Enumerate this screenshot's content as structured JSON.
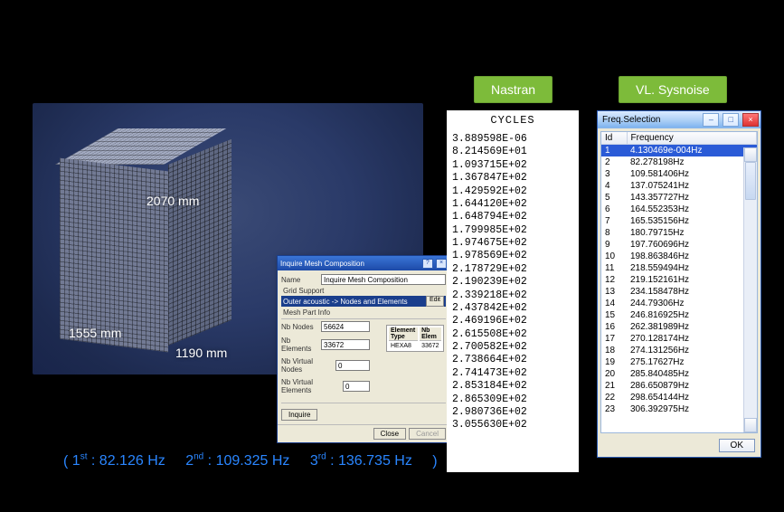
{
  "viewport": {
    "dim_height": "2070 mm",
    "dim_width": "1555 mm",
    "dim_depth": "1190 mm"
  },
  "mesh_dialog": {
    "title": "Inquire Mesh Composition",
    "name_label": "Name",
    "name_value": "Inquire Mesh Composition",
    "grid_support_label": "Grid Support",
    "selection_text": "Outer acoustic -> Nodes and Elements",
    "edit_btn": "Edit",
    "mesh_part_info_label": "Mesh Part Info",
    "nb_nodes_label": "Nb Nodes",
    "nb_nodes_value": "56624",
    "nb_elements_label": "Nb Elements",
    "nb_elements_value": "33672",
    "nb_vnodes_label": "Nb Virtual Nodes",
    "nb_vnodes_value": "0",
    "nb_velems_label": "Nb Virtual Elements",
    "nb_velems_value": "0",
    "elem_type_header": "Element Type",
    "nb_elem_header": "Nb Elem",
    "elem_type_val": "HEXA8",
    "nb_elem_val": "33672",
    "inquire_btn": "Inquire",
    "close_btn": "Close",
    "cancel_btn": "Cancel"
  },
  "tags": {
    "nastran": "Nastran",
    "sysnoise": "VL. Sysnoise"
  },
  "cycles": {
    "title": "CYCLES",
    "values": [
      "3.889598E-06",
      "8.214569E+01",
      "1.093715E+02",
      "1.367847E+02",
      "1.429592E+02",
      "1.644120E+02",
      "1.648794E+02",
      "1.799985E+02",
      "1.974675E+02",
      "1.978569E+02",
      "2.178729E+02",
      "2.190239E+02",
      "2.339218E+02",
      "2.437842E+02",
      "2.469196E+02",
      "2.615508E+02",
      "2.700582E+02",
      "2.738664E+02",
      "2.741473E+02",
      "2.853184E+02",
      "2.865309E+02",
      "2.980736E+02",
      "3.055630E+02"
    ]
  },
  "freq_window": {
    "title": "Freq.Selection",
    "min_icon": "–",
    "max_icon": "□",
    "close_icon": "×",
    "col_id": "Id",
    "col_freq": "Frequency",
    "rows": [
      {
        "id": "1",
        "freq": "4.130469e-004Hz",
        "selected": true
      },
      {
        "id": "2",
        "freq": "82.278198Hz"
      },
      {
        "id": "3",
        "freq": "109.581406Hz"
      },
      {
        "id": "4",
        "freq": "137.075241Hz"
      },
      {
        "id": "5",
        "freq": "143.357727Hz"
      },
      {
        "id": "6",
        "freq": "164.552353Hz"
      },
      {
        "id": "7",
        "freq": "165.535156Hz"
      },
      {
        "id": "8",
        "freq": "180.79715Hz"
      },
      {
        "id": "9",
        "freq": "197.760696Hz"
      },
      {
        "id": "10",
        "freq": "198.863846Hz"
      },
      {
        "id": "11",
        "freq": "218.559494Hz"
      },
      {
        "id": "12",
        "freq": "219.152161Hz"
      },
      {
        "id": "13",
        "freq": "234.158478Hz"
      },
      {
        "id": "14",
        "freq": "244.79306Hz"
      },
      {
        "id": "15",
        "freq": "246.816925Hz"
      },
      {
        "id": "16",
        "freq": "262.381989Hz"
      },
      {
        "id": "17",
        "freq": "270.128174Hz"
      },
      {
        "id": "18",
        "freq": "274.131256Hz"
      },
      {
        "id": "19",
        "freq": "275.17627Hz"
      },
      {
        "id": "20",
        "freq": "285.840485Hz"
      },
      {
        "id": "21",
        "freq": "286.650879Hz"
      },
      {
        "id": "22",
        "freq": "298.654144Hz"
      },
      {
        "id": "23",
        "freq": "306.392975Hz"
      }
    ],
    "ok_btn": "OK"
  },
  "bottom": {
    "open": "(",
    "s1": "1",
    "s1_ord": "st",
    "s1_val": " : 82.126 Hz",
    "s2": "2",
    "s2_ord": "nd",
    "s2_val": " : 109.325 Hz",
    "s3": "3",
    "s3_ord": "rd",
    "s3_val": " : 136.735 Hz",
    "close": ")"
  }
}
